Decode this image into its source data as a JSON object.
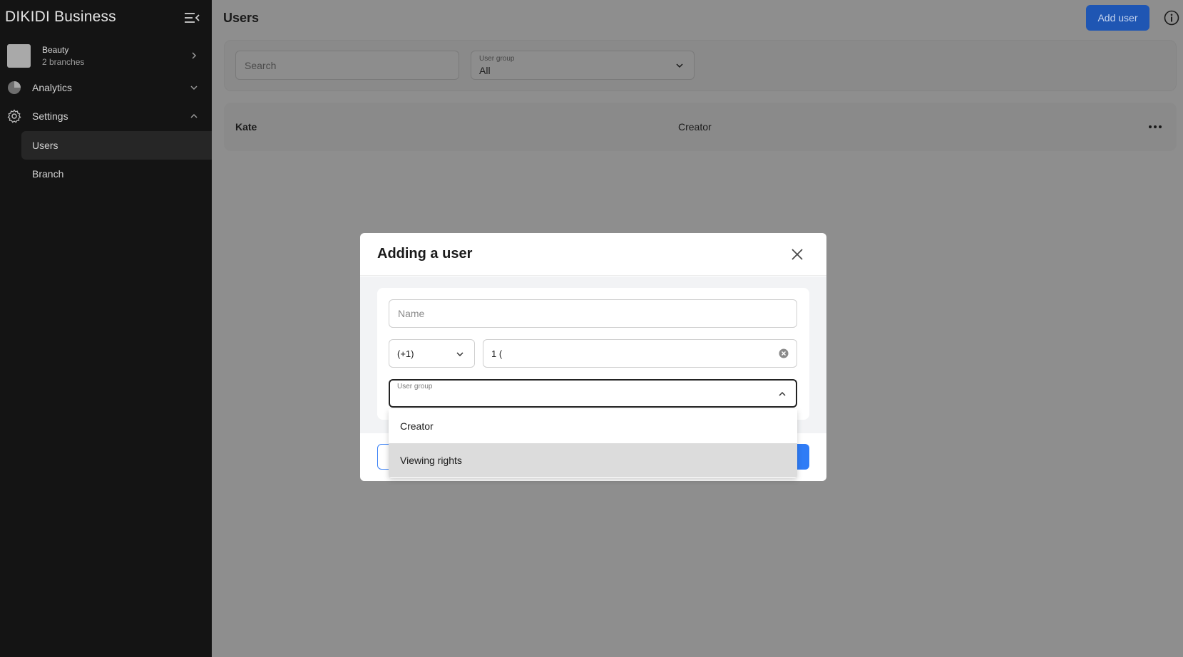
{
  "sidebar": {
    "brand": "DIKIDI Business",
    "branch": {
      "name": "Beauty",
      "subtitle": "2 branches"
    },
    "items": [
      {
        "label": "Analytics",
        "icon": "pie-chart-icon",
        "expanded": false
      },
      {
        "label": "Settings",
        "icon": "gear-icon",
        "expanded": true
      }
    ],
    "subitems": [
      {
        "label": "Users",
        "active": true
      },
      {
        "label": "Branch",
        "active": false
      }
    ]
  },
  "header": {
    "title": "Users",
    "add_user_label": "Add user"
  },
  "filters": {
    "search_placeholder": "Search",
    "user_group_label": "User group",
    "user_group_value": "All"
  },
  "users": [
    {
      "name": "Kate",
      "role": "Creator"
    }
  ],
  "modal": {
    "title": "Adding a user",
    "name_placeholder": "Name",
    "country_code": "(+1)",
    "phone_value": "1 (",
    "user_group_label": "User group",
    "user_group_options": [
      "Creator",
      "Viewing rights"
    ],
    "hovered_option": "Viewing rights"
  },
  "colors": {
    "sidebar_bg": "#141414",
    "overlay": "#8e8e8e",
    "accent": "#2f7cf6",
    "add_user_bg": "#1f56b3"
  }
}
